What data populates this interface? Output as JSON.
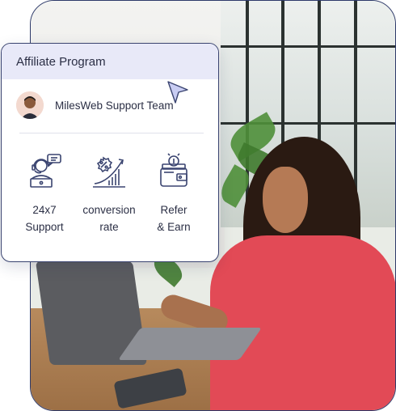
{
  "card": {
    "title": "Affiliate Program",
    "team_name": "MilesWeb Support Team",
    "features": [
      {
        "line1": "24x7",
        "line2": "Support",
        "icon": "headset-agent-icon"
      },
      {
        "line1": "conversion",
        "line2": "rate",
        "icon": "percent-growth-chart-icon"
      },
      {
        "line1": "Refer",
        "line2": "& Earn",
        "icon": "wallet-coins-icon"
      }
    ]
  },
  "colors": {
    "accent": "#3a4470",
    "header_bg": "#e8e9f8",
    "cursor": "#c9cdf3"
  }
}
